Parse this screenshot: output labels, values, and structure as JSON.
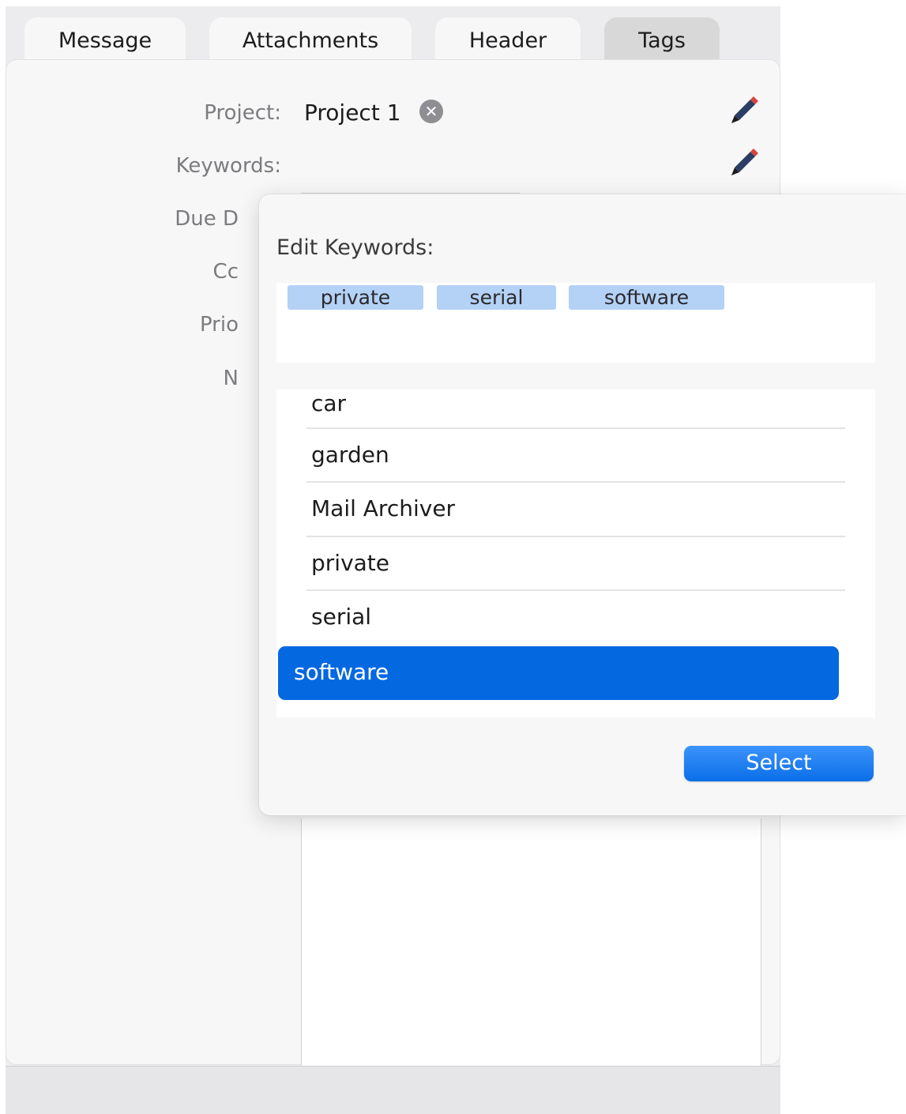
{
  "tabs": [
    {
      "label": "Message"
    },
    {
      "label": "Attachments"
    },
    {
      "label": "Header"
    },
    {
      "label": "Tags",
      "active": true
    }
  ],
  "form": {
    "project_label": "Project:",
    "project_value": "Project 1",
    "keywords_label": "Keywords:",
    "due_label": "Due D",
    "color_label": "Cc",
    "priority_label": "Prio",
    "notes_label": "N"
  },
  "popover": {
    "title": "Edit Keywords:",
    "tokens": [
      "private",
      "serial",
      "software"
    ],
    "list": [
      "car",
      "garden",
      "Mail Archiver",
      "private",
      "serial",
      "software"
    ],
    "selected_item": "software",
    "select_button": "Select"
  },
  "colors": {
    "accent": "#0468e1",
    "token_bg": "#b4d1f6",
    "pencil_body": "#2c3e63",
    "pencil_tip": "#d9453a"
  },
  "icons": [
    "clear-icon",
    "pencil-icon"
  ]
}
